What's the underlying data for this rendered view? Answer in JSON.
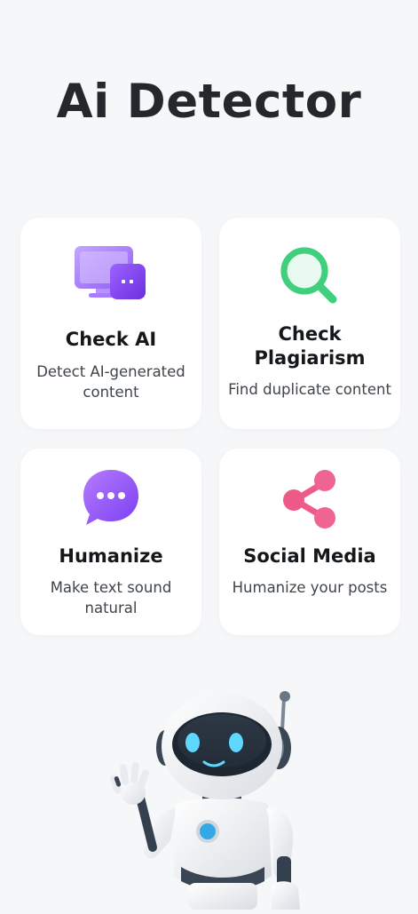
{
  "app": {
    "title": "Ai Detector"
  },
  "cards": [
    {
      "title": "Check AI",
      "description": "Detect AI-generated content",
      "icon": "monitor-chat-icon",
      "color": "#8b5cf6"
    },
    {
      "title": "Check Plagiarism",
      "description": "Find duplicate content",
      "icon": "magnifier-icon",
      "color": "#34c77a"
    },
    {
      "title": "Humanize",
      "description": "Make text sound natural",
      "icon": "chat-bubble-icon",
      "color": "#8b5cf6"
    },
    {
      "title": "Social Media",
      "description": "Humanize your posts",
      "icon": "share-icon",
      "color": "#ef5b89"
    }
  ],
  "mascot": {
    "icon": "robot-waving-icon"
  }
}
